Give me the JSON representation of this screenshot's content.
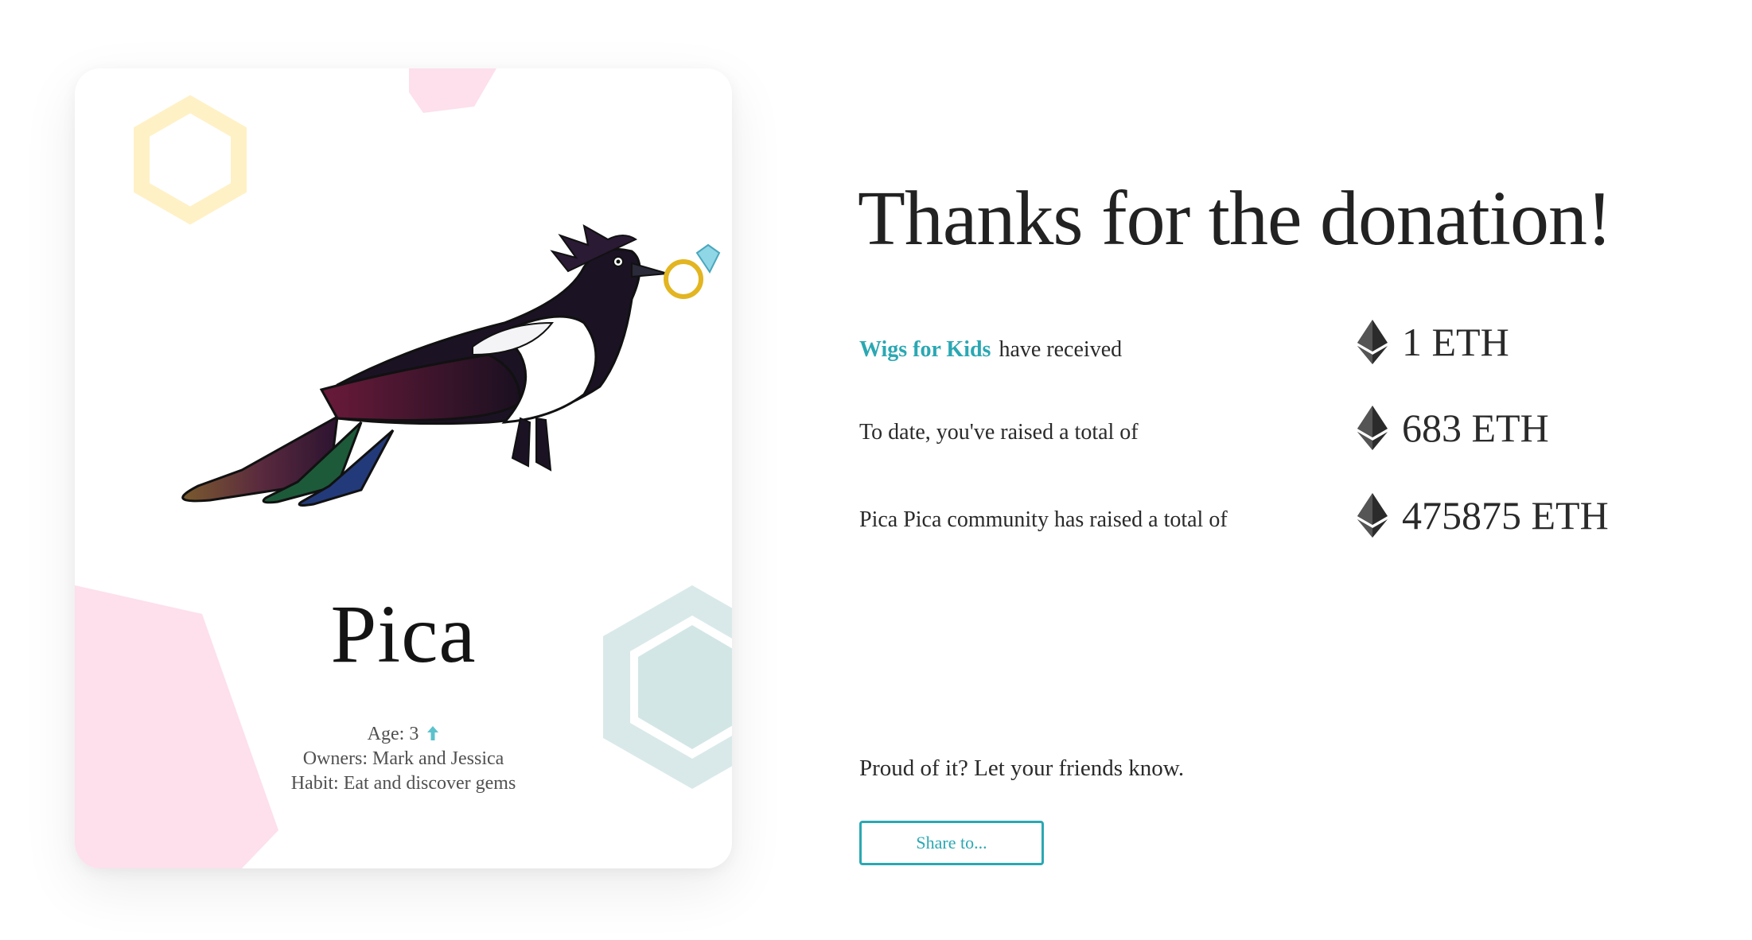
{
  "heading": "Thanks for the donation!",
  "pet": {
    "name": "Pica",
    "age_label": "Age: 3",
    "owners_label": "Owners: Mark and Jessica",
    "habit_label": "Habit: Eat and discover gems"
  },
  "stats": [
    {
      "org": "Wigs for Kids",
      "label": "have received",
      "amount": "1 ETH"
    },
    {
      "org": "",
      "label": "To date, you've raised a total of",
      "amount": "683 ETH"
    },
    {
      "org": "",
      "label": "Pica Pica community has raised a total of",
      "amount": "475875 ETH"
    }
  ],
  "share": {
    "prompt": "Proud of it? Let your friends know.",
    "button_label": "Share to..."
  },
  "colors": {
    "accent": "#2aa8b3",
    "pink": "#fde0ec",
    "yellow": "#fff1c6",
    "teal_light": "#d6e8e8"
  },
  "icons": {
    "currency": "ethereum-icon",
    "age": "arrow-up-icon"
  }
}
